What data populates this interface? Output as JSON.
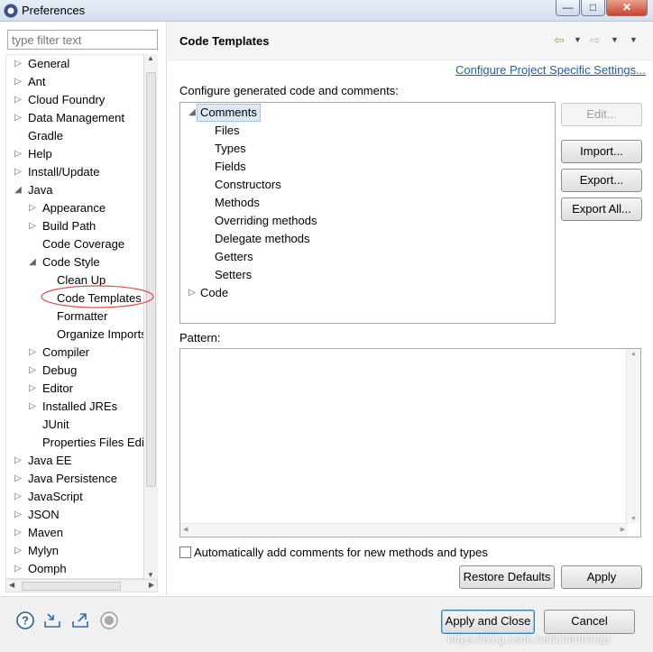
{
  "window": {
    "title": "Preferences"
  },
  "filter": {
    "placeholder": "type filter text"
  },
  "left_tree": [
    {
      "label": "General",
      "level": 0,
      "twisty": "closed"
    },
    {
      "label": "Ant",
      "level": 0,
      "twisty": "closed"
    },
    {
      "label": "Cloud Foundry",
      "level": 0,
      "twisty": "closed"
    },
    {
      "label": "Data Management",
      "level": 0,
      "twisty": "closed"
    },
    {
      "label": "Gradle",
      "level": 0,
      "twisty": "none"
    },
    {
      "label": "Help",
      "level": 0,
      "twisty": "closed"
    },
    {
      "label": "Install/Update",
      "level": 0,
      "twisty": "closed"
    },
    {
      "label": "Java",
      "level": 0,
      "twisty": "open"
    },
    {
      "label": "Appearance",
      "level": 1,
      "twisty": "closed"
    },
    {
      "label": "Build Path",
      "level": 1,
      "twisty": "closed"
    },
    {
      "label": "Code Coverage",
      "level": 1,
      "twisty": "none"
    },
    {
      "label": "Code Style",
      "level": 1,
      "twisty": "open"
    },
    {
      "label": "Clean Up",
      "level": 2,
      "twisty": "none"
    },
    {
      "label": "Code Templates",
      "level": 2,
      "twisty": "none",
      "selected": true
    },
    {
      "label": "Formatter",
      "level": 2,
      "twisty": "none"
    },
    {
      "label": "Organize Imports",
      "level": 2,
      "twisty": "none"
    },
    {
      "label": "Compiler",
      "level": 1,
      "twisty": "closed"
    },
    {
      "label": "Debug",
      "level": 1,
      "twisty": "closed"
    },
    {
      "label": "Editor",
      "level": 1,
      "twisty": "closed"
    },
    {
      "label": "Installed JREs",
      "level": 1,
      "twisty": "closed"
    },
    {
      "label": "JUnit",
      "level": 1,
      "twisty": "none"
    },
    {
      "label": "Properties Files Editor",
      "level": 1,
      "twisty": "none"
    },
    {
      "label": "Java EE",
      "level": 0,
      "twisty": "closed"
    },
    {
      "label": "Java Persistence",
      "level": 0,
      "twisty": "closed"
    },
    {
      "label": "JavaScript",
      "level": 0,
      "twisty": "closed"
    },
    {
      "label": "JSON",
      "level": 0,
      "twisty": "closed"
    },
    {
      "label": "Maven",
      "level": 0,
      "twisty": "closed"
    },
    {
      "label": "Mylyn",
      "level": 0,
      "twisty": "closed"
    },
    {
      "label": "Oomph",
      "level": 0,
      "twisty": "closed"
    }
  ],
  "page": {
    "title": "Code Templates",
    "project_link": "Configure Project Specific Settings...",
    "configure_label": "Configure generated code and comments:",
    "pattern_label": "Pattern:",
    "checkbox_label": "Automatically add comments for new methods and types",
    "checkbox_checked": false
  },
  "code_tree": [
    {
      "label": "Comments",
      "level": 0,
      "twisty": "open",
      "selected": true
    },
    {
      "label": "Files",
      "level": 1
    },
    {
      "label": "Types",
      "level": 1
    },
    {
      "label": "Fields",
      "level": 1
    },
    {
      "label": "Constructors",
      "level": 1
    },
    {
      "label": "Methods",
      "level": 1
    },
    {
      "label": "Overriding methods",
      "level": 1
    },
    {
      "label": "Delegate methods",
      "level": 1
    },
    {
      "label": "Getters",
      "level": 1
    },
    {
      "label": "Setters",
      "level": 1
    },
    {
      "label": "Code",
      "level": 0,
      "twisty": "closed"
    }
  ],
  "buttons": {
    "edit": "Edit...",
    "import": "Import...",
    "export": "Export...",
    "export_all": "Export All...",
    "restore_defaults": "Restore Defaults",
    "apply": "Apply",
    "apply_close": "Apply and Close",
    "cancel": "Cancel"
  },
  "watermark": "https://blog.csdn.net/chenbinqq",
  "colors": {
    "link": "#1a5fb4",
    "selection_circle": "#e05050",
    "selected_bg": "#dbe9f7"
  }
}
